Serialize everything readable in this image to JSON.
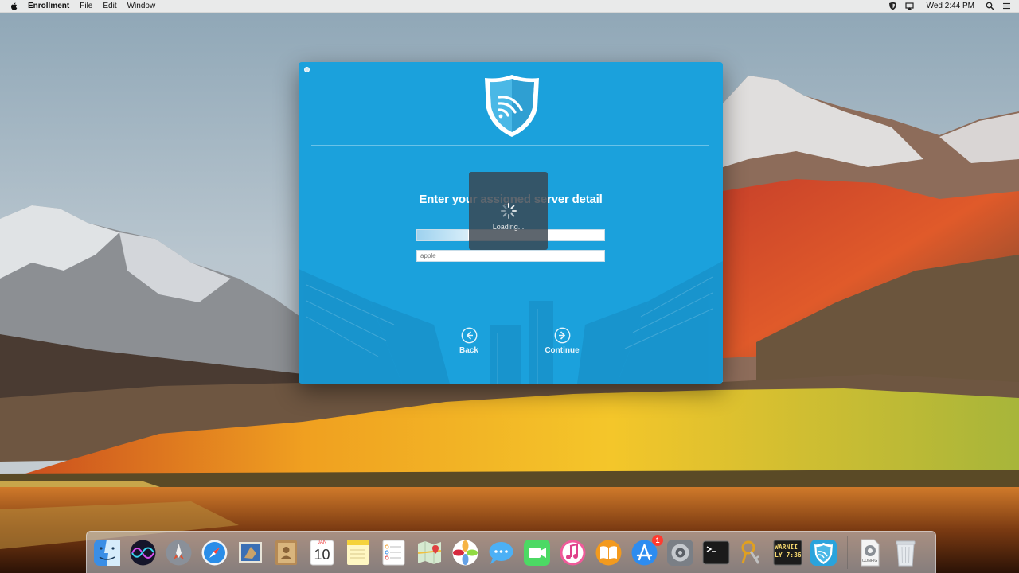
{
  "menubar": {
    "app_name": "Enrollment",
    "menus": [
      "File",
      "Edit",
      "Window"
    ],
    "clock": "Wed 2:44 PM"
  },
  "window": {
    "heading": "Enter your assigned server detail",
    "server_field": {
      "value": ""
    },
    "org_field": {
      "placeholder": "apple"
    },
    "back_label": "Back",
    "continue_label": "Continue",
    "loading_text": "Loading...",
    "colors": {
      "background": "#1ba1dc",
      "shield": "#5bc4ee"
    }
  },
  "dock": {
    "apps": [
      {
        "name": "finder-icon",
        "running": true
      },
      {
        "name": "siri-icon",
        "running": false
      },
      {
        "name": "launchpad-icon",
        "running": false
      },
      {
        "name": "safari-icon",
        "running": false
      },
      {
        "name": "mail-icon",
        "running": false
      },
      {
        "name": "contacts-icon",
        "running": false
      },
      {
        "name": "calendar-icon",
        "running": false,
        "month": "JAN",
        "day": "10"
      },
      {
        "name": "notes-icon",
        "running": false
      },
      {
        "name": "reminders-icon",
        "running": false
      },
      {
        "name": "maps-icon",
        "running": false
      },
      {
        "name": "photos-icon",
        "running": false
      },
      {
        "name": "messages-icon",
        "running": false
      },
      {
        "name": "facetime-icon",
        "running": false
      },
      {
        "name": "itunes-icon",
        "running": false
      },
      {
        "name": "ibooks-icon",
        "running": false
      },
      {
        "name": "app-store-icon",
        "running": false,
        "badge": "1"
      },
      {
        "name": "system-preferences-icon",
        "running": false
      },
      {
        "name": "terminal-icon",
        "running": true
      },
      {
        "name": "keychain-icon",
        "running": false
      },
      {
        "name": "console-icon",
        "running": true,
        "text": "WARNI\nLY 7:36"
      },
      {
        "name": "enrollment-icon",
        "running": true
      },
      {
        "name": "config-profile-icon",
        "running": false,
        "label": "CONFIG"
      },
      {
        "name": "trash-icon",
        "running": false
      }
    ]
  }
}
